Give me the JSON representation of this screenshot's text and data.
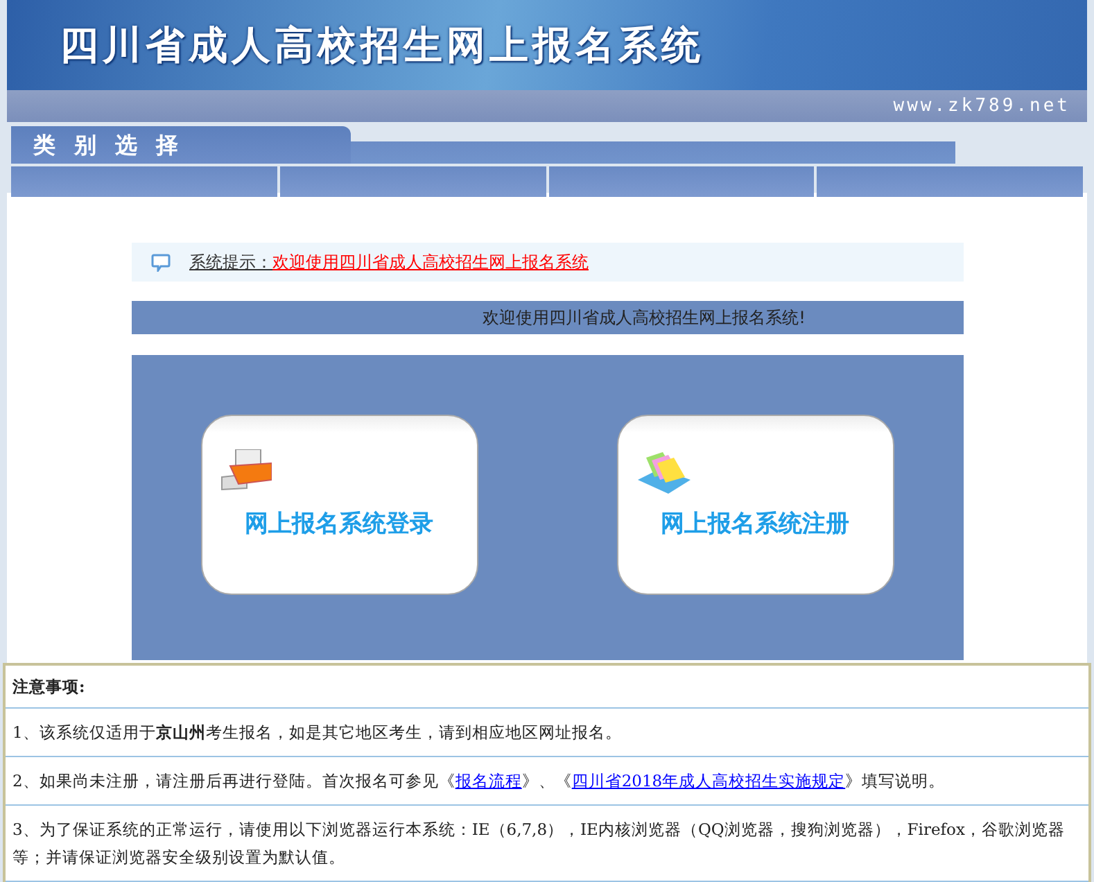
{
  "header": {
    "title": "四川省成人高校招生网上报名系统",
    "url": "www.zk789.net"
  },
  "category": {
    "title": "类 别 选 择"
  },
  "tip": {
    "label": "系统提示：",
    "message": "欢迎使用四川省成人高校招生网上报名系统"
  },
  "welcome": "欢迎使用四川省成人高校招生网上报名系统!",
  "cards": [
    {
      "kind": "login",
      "label": "网上报名系统登录"
    },
    {
      "kind": "register",
      "label": "网上报名系统注册"
    }
  ],
  "notices": {
    "title": "注意事项:",
    "items": [
      {
        "segments": [
          {
            "kind": "text",
            "text": "1、该系统仅适用于**京山州**考生报名，如是其它地区考生，请到相应地区网址报名。"
          }
        ]
      },
      {
        "segments": [
          {
            "kind": "text",
            "text": "2、如果尚未注册，请注册后再进行登陆。首次报名可参见《"
          },
          {
            "kind": "link",
            "text": "报名流程"
          },
          {
            "kind": "text",
            "text": "》、《"
          },
          {
            "kind": "link",
            "text": "四川省2018年成人高校招生实施规定"
          },
          {
            "kind": "text",
            "text": "》填写说明。"
          }
        ]
      },
      {
        "segments": [
          {
            "kind": "text",
            "text": "3、为了保证系统的正常运行，请使用以下浏览器运行本系统：IE（6,7,8），IE内核浏览器（QQ浏览器，搜狗浏览器），Firefox，谷歌浏览器等；并请保证浏览器安全级别设置为默认值。"
          }
        ]
      }
    ]
  }
}
